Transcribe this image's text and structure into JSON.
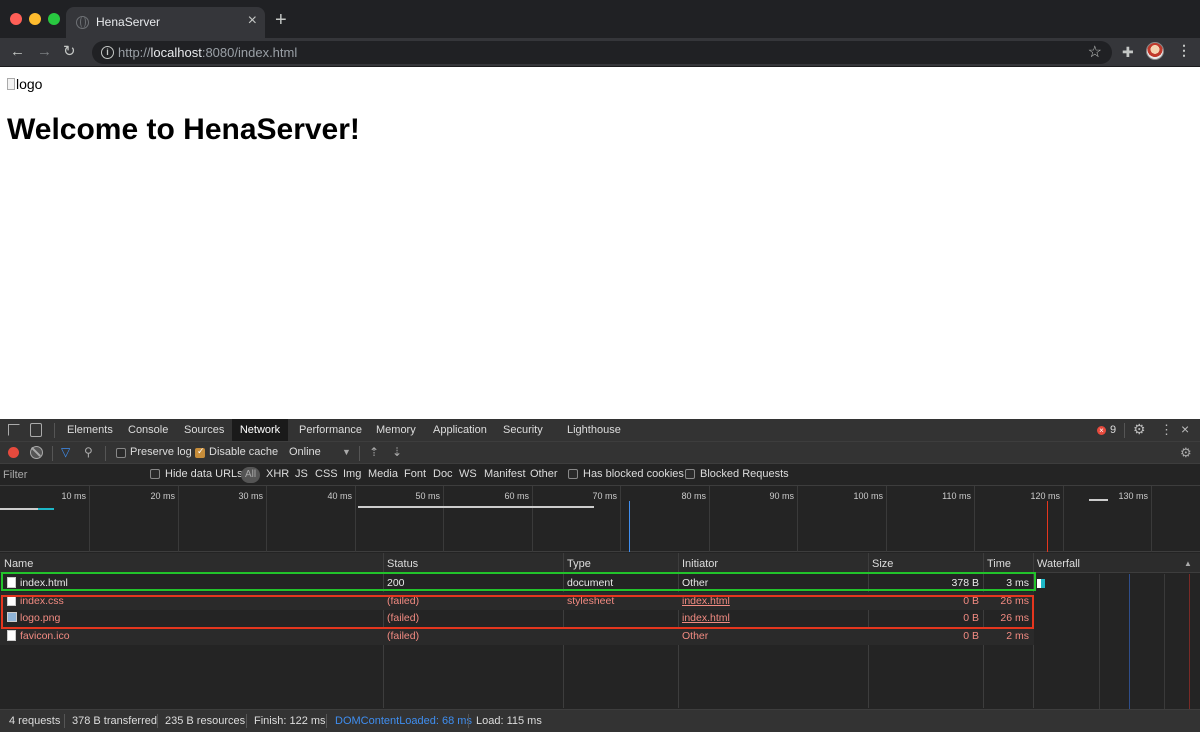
{
  "browser": {
    "tab_title": "HenaServer",
    "url_prefix": "http://",
    "url_host": "localhost",
    "url_rest": ":8080/index.html"
  },
  "page": {
    "img_alt": "logo",
    "heading": "Welcome to HenaServer!"
  },
  "devtools": {
    "tabs": [
      "Elements",
      "Console",
      "Sources",
      "Network",
      "Performance",
      "Memory",
      "Application",
      "Security",
      "Lighthouse"
    ],
    "active_tab": "Network",
    "error_count": "9",
    "toolbar": {
      "preserve_log": "Preserve log",
      "preserve_log_checked": false,
      "disable_cache": "Disable cache",
      "disable_cache_checked": true,
      "throttling": "Online"
    },
    "filter": {
      "placeholder": "Filter",
      "hide_data_urls": "Hide data URLs",
      "types": [
        "All",
        "XHR",
        "JS",
        "CSS",
        "Img",
        "Media",
        "Font",
        "Doc",
        "WS",
        "Manifest",
        "Other"
      ],
      "has_blocked_cookies": "Has blocked cookies",
      "blocked_requests": "Blocked Requests"
    },
    "overview_ticks": [
      "10 ms",
      "20 ms",
      "30 ms",
      "40 ms",
      "50 ms",
      "60 ms",
      "70 ms",
      "80 ms",
      "90 ms",
      "100 ms",
      "110 ms",
      "120 ms",
      "130 ms"
    ],
    "columns": [
      "Name",
      "Status",
      "Type",
      "Initiator",
      "Size",
      "Time",
      "Waterfall"
    ],
    "requests": [
      {
        "name": "index.html",
        "status": "200",
        "type": "document",
        "initiator": "Other",
        "size": "378 B",
        "time": "3 ms",
        "failed": false
      },
      {
        "name": "index.css",
        "status": "(failed)",
        "type": "stylesheet",
        "initiator": "index.html",
        "size": "0 B",
        "time": "26 ms",
        "failed": true
      },
      {
        "name": "logo.png",
        "status": "(failed)",
        "type": "",
        "initiator": "index.html",
        "size": "0 B",
        "time": "26 ms",
        "failed": true
      },
      {
        "name": "favicon.ico",
        "status": "(failed)",
        "type": "",
        "initiator": "Other",
        "size": "0 B",
        "time": "2 ms",
        "failed": true
      }
    ],
    "summary": {
      "requests": "4 requests",
      "transferred": "378 B transferred",
      "resources": "235 B resources",
      "finish": "Finish: 122 ms",
      "dom_content_loaded": "DOMContentLoaded: 68 ms",
      "load": "Load: 115 ms"
    }
  },
  "colors": {
    "highlight_success": "#22c32b",
    "highlight_failed": "#e5361e",
    "failed_text": "#f28b82",
    "dom_content_loaded": "#3f8ef0"
  }
}
